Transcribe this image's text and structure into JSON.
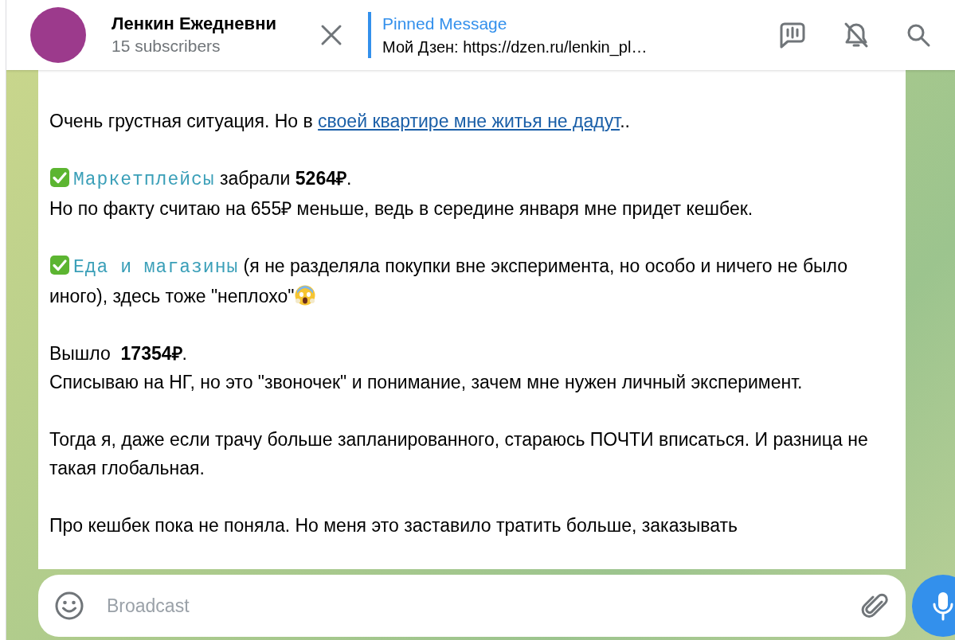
{
  "header": {
    "title": "Ленкин Ежедневни",
    "subtitle": "15 subscribers",
    "pinned": {
      "label": "Pinned Message",
      "text": "Мой Дзен: https://dzen.ru/lenkin_pl…"
    }
  },
  "message": {
    "paragraphs": [
      {
        "lines": [
          [
            {
              "kind": "text",
              "text": "Очень грустная ситуация. Но в "
            },
            {
              "kind": "link",
              "text": "своей квартире мне житья не дадут"
            },
            {
              "kind": "text",
              "text": ".."
            }
          ]
        ]
      },
      {
        "lines": [
          [
            {
              "kind": "check"
            },
            {
              "kind": "mono",
              "text": "Маркетплейсы"
            },
            {
              "kind": "text",
              "text": " забрали **5264₽**."
            }
          ],
          [
            {
              "kind": "text",
              "text": "Но по факту считаю на 655₽ меньше, ведь в середине января мне придет кешбек."
            }
          ]
        ]
      },
      {
        "lines": [
          [
            {
              "kind": "check"
            },
            {
              "kind": "mono",
              "text": "Еда и магазины"
            },
            {
              "kind": "text",
              "text": " (я не разделяла покупки вне эксперимента, но особо и ничего не было иного), здесь тоже \"неплохо\""
            },
            {
              "kind": "scream"
            }
          ]
        ]
      },
      {
        "lines": [
          [
            {
              "kind": "text",
              "text": "Вышло  **17354₽**."
            }
          ],
          [
            {
              "kind": "text",
              "text": "Списываю на НГ, но это \"звоночек\" и понимание, зачем мне нужен личный эксперимент."
            }
          ]
        ]
      },
      {
        "lines": [
          [
            {
              "kind": "text",
              "text": "Тогда я, даже если трачу больше запланированного, стараюсь ПОЧТИ вписаться. И разница не такая глобальная."
            }
          ]
        ]
      },
      {
        "lines": [
          [
            {
              "kind": "text",
              "text": "Про кешбек пока не поняла. Но меня это заставило тратить больше, заказывать"
            }
          ]
        ]
      }
    ]
  },
  "composer": {
    "placeholder": "Broadcast"
  }
}
